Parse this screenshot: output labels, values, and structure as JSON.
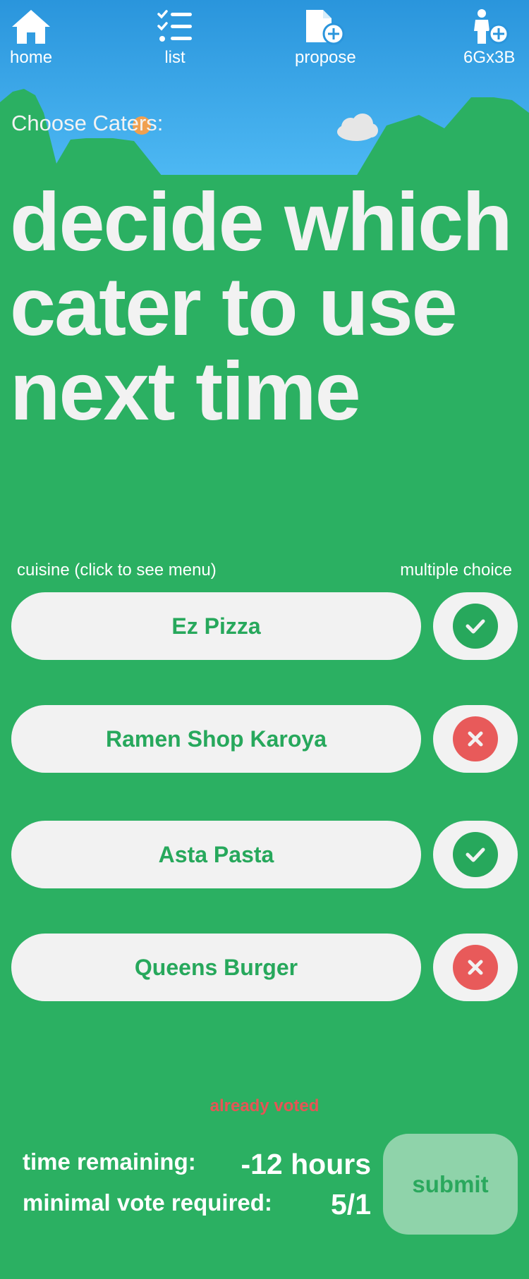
{
  "nav": {
    "items": [
      {
        "label": "home",
        "icon": "home-icon"
      },
      {
        "label": "list",
        "icon": "list-icon"
      },
      {
        "label": "propose",
        "icon": "file-add-icon"
      },
      {
        "label": "6Gx3B",
        "icon": "user-add-icon"
      }
    ]
  },
  "section_label": "Choose Caters:",
  "headline": "decide which cater to use next time",
  "columns": {
    "left": "cuisine (click to see menu)",
    "right": "multiple choice"
  },
  "options": [
    {
      "name": "Ez Pizza",
      "vote": "yes"
    },
    {
      "name": "Ramen Shop Karoya",
      "vote": "no"
    },
    {
      "name": "Asta Pasta",
      "vote": "yes"
    },
    {
      "name": "Queens Burger",
      "vote": "no"
    }
  ],
  "status_text": "already voted",
  "info": {
    "time_label": "time remaining:",
    "time_value": "-12 hours",
    "votes_label": "minimal vote required:",
    "votes_value": "5/1"
  },
  "submit_label": "submit",
  "colors": {
    "background": "#2bb062",
    "sky_top": "#2a95dc",
    "sky_bottom": "#4db5f2",
    "yes": "#27a85c",
    "no": "#e85a5a",
    "submit_bg": "#8fd3aa"
  }
}
